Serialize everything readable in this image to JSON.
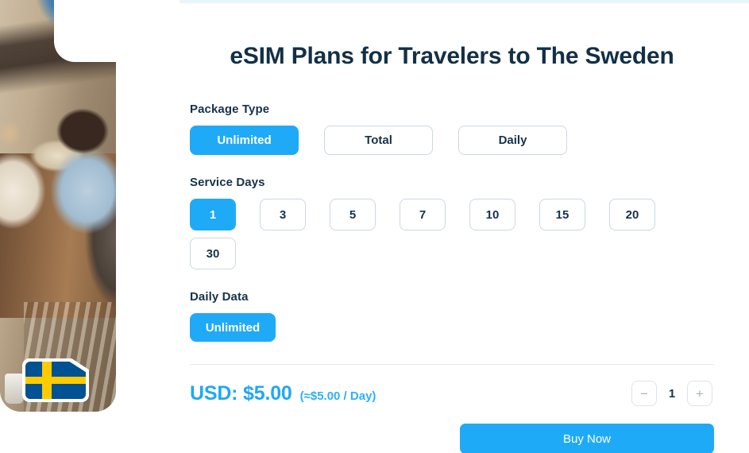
{
  "page": {
    "title": "eSIM Plans for Travelers to The Sweden"
  },
  "hero": {
    "photo_alt": "travelers-dining-outdoors-photo",
    "flag_name": "sweden-flag-badge",
    "flag_colors": {
      "field": "#005293",
      "cross": "#fecb00"
    }
  },
  "theme": {
    "accent": "#1faaf7",
    "text_dark": "#17324a",
    "border": "#ccd8e0",
    "divider": "#e5e7ea"
  },
  "package_type": {
    "label": "Package Type",
    "options": [
      {
        "label": "Unlimited",
        "selected": true
      },
      {
        "label": "Total",
        "selected": false
      },
      {
        "label": "Daily",
        "selected": false
      }
    ]
  },
  "service_days": {
    "label": "Service Days",
    "options": [
      {
        "label": "1",
        "selected": true
      },
      {
        "label": "3",
        "selected": false
      },
      {
        "label": "5",
        "selected": false
      },
      {
        "label": "7",
        "selected": false
      },
      {
        "label": "10",
        "selected": false
      },
      {
        "label": "15",
        "selected": false
      },
      {
        "label": "20",
        "selected": false
      },
      {
        "label": "30",
        "selected": false
      }
    ]
  },
  "daily_data": {
    "label": "Daily Data",
    "options": [
      {
        "label": "Unlimited",
        "selected": true
      }
    ]
  },
  "price": {
    "main": "USD: $5.00",
    "per_day": "(≈$5.00 / Day)"
  },
  "quantity": {
    "decrease_label": "−",
    "value": "1",
    "increase_label": "+"
  },
  "buy": {
    "label": "Buy Now"
  }
}
